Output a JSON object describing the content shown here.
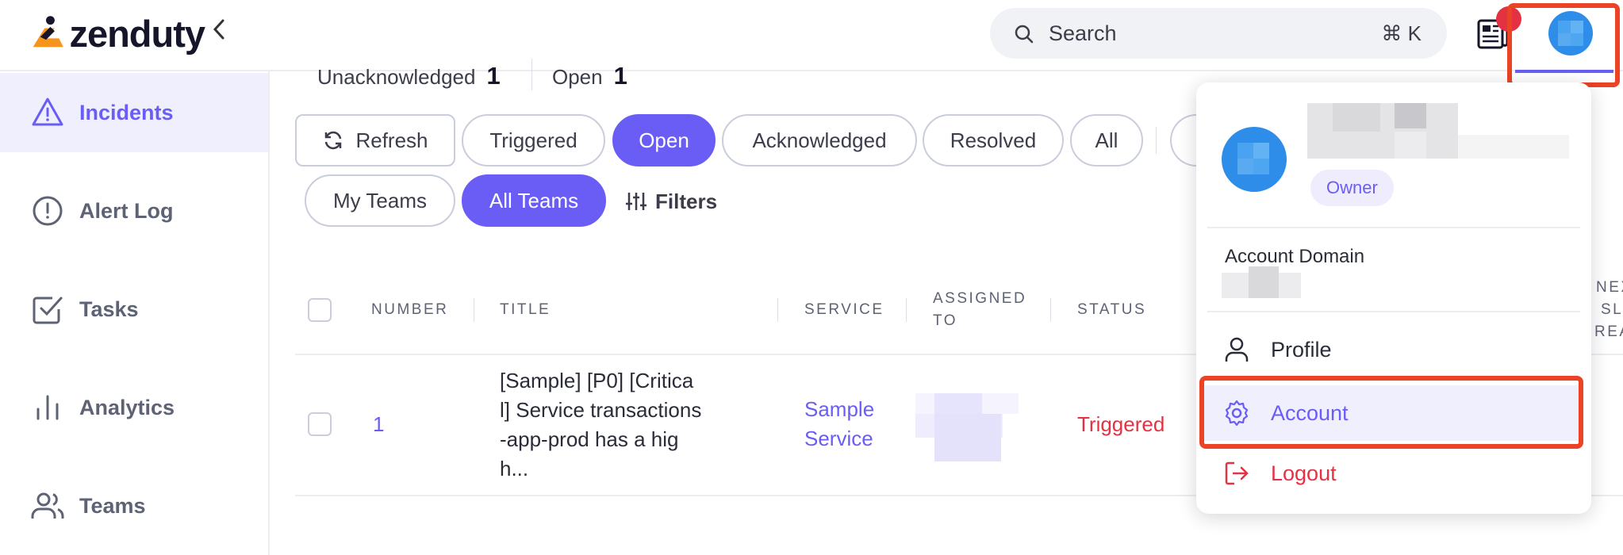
{
  "app": {
    "logo_text": "zenduty",
    "brand_color": "#6a5df5",
    "danger_color": "#e53243",
    "logo_accent": "#f7941d"
  },
  "header": {
    "search_placeholder": "Search",
    "search_shortcut": "⌘ K",
    "news_icon": "newspaper-icon",
    "collapse_icon": "chevron-left-icon"
  },
  "sidebar": {
    "items": [
      {
        "label": "Incidents",
        "icon": "warning-triangle-icon",
        "active": true
      },
      {
        "label": "Alert Log",
        "icon": "alert-circle-icon",
        "active": false
      },
      {
        "label": "Tasks",
        "icon": "checkbox-icon",
        "active": false
      },
      {
        "label": "Analytics",
        "icon": "bar-chart-icon",
        "active": false
      },
      {
        "label": "Teams",
        "icon": "users-icon",
        "active": false
      }
    ]
  },
  "counts": {
    "unacknowledged_label": "Unacknowledged",
    "unacknowledged_value": "1",
    "open_label": "Open",
    "open_value": "1"
  },
  "filters": {
    "refresh": "Refresh",
    "status_tabs": [
      "Triggered",
      "Open",
      "Acknowledged",
      "Resolved",
      "All"
    ],
    "selected_status": "Open",
    "team_tabs": [
      "My Teams",
      "All Teams"
    ],
    "selected_team": "All Teams",
    "filters_label": "Filters"
  },
  "table": {
    "headers": {
      "number": "NUMBER",
      "title": "TITLE",
      "service": "SERVICE",
      "assigned_line1": "ASSIGNED",
      "assigned_line2": "TO",
      "status": "STATUS",
      "next_line1": "NEX",
      "next_line2": "SL",
      "next_line3": "REA"
    },
    "rows": [
      {
        "number": "1",
        "title_lines": [
          "[Sample] [P0] [Critica",
          "l] Service transactions",
          "-app-prod has a hig",
          "h..."
        ],
        "service_lines": [
          "Sample",
          "Service"
        ],
        "status": "Triggered"
      }
    ]
  },
  "user_menu": {
    "role_badge": "Owner",
    "account_domain_label": "Account Domain",
    "items": [
      {
        "label": "Profile",
        "icon": "user-icon"
      },
      {
        "label": "Account",
        "icon": "gear-icon"
      },
      {
        "label": "Logout",
        "icon": "logout-icon"
      }
    ]
  }
}
